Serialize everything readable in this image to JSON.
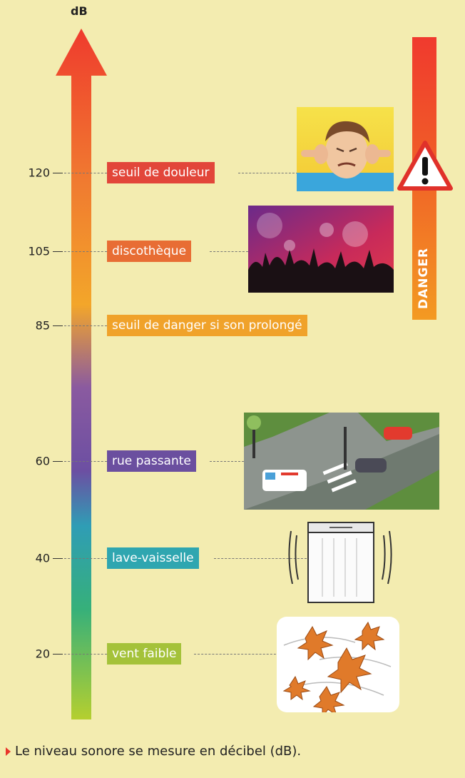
{
  "scale": {
    "unit": "dB",
    "ticks": [
      {
        "value": "120",
        "label": "seuil de douleur",
        "color": "#e2463a"
      },
      {
        "value": "105",
        "label": "discothèque",
        "color": "#e86d34"
      },
      {
        "value": "85",
        "label": "seuil de danger si son prolongé",
        "color": "#f0a22a"
      },
      {
        "value": "60",
        "label": "rue passante",
        "color": "#6b4f9f"
      },
      {
        "value": "40",
        "label": "lave-vaisselle",
        "color": "#2fa6b0"
      },
      {
        "value": "20",
        "label": "vent faible",
        "color": "#a4c23a"
      }
    ]
  },
  "danger": {
    "label": "DANGER",
    "color": "#f03a2e"
  },
  "illustrations": [
    "person-covering-ears-image",
    "nightclub-crowd-image",
    "street-traffic-image",
    "dishwasher-image",
    "autumn-leaves-image"
  ],
  "caption": "Le niveau sonore se mesure en décibel (dB)."
}
